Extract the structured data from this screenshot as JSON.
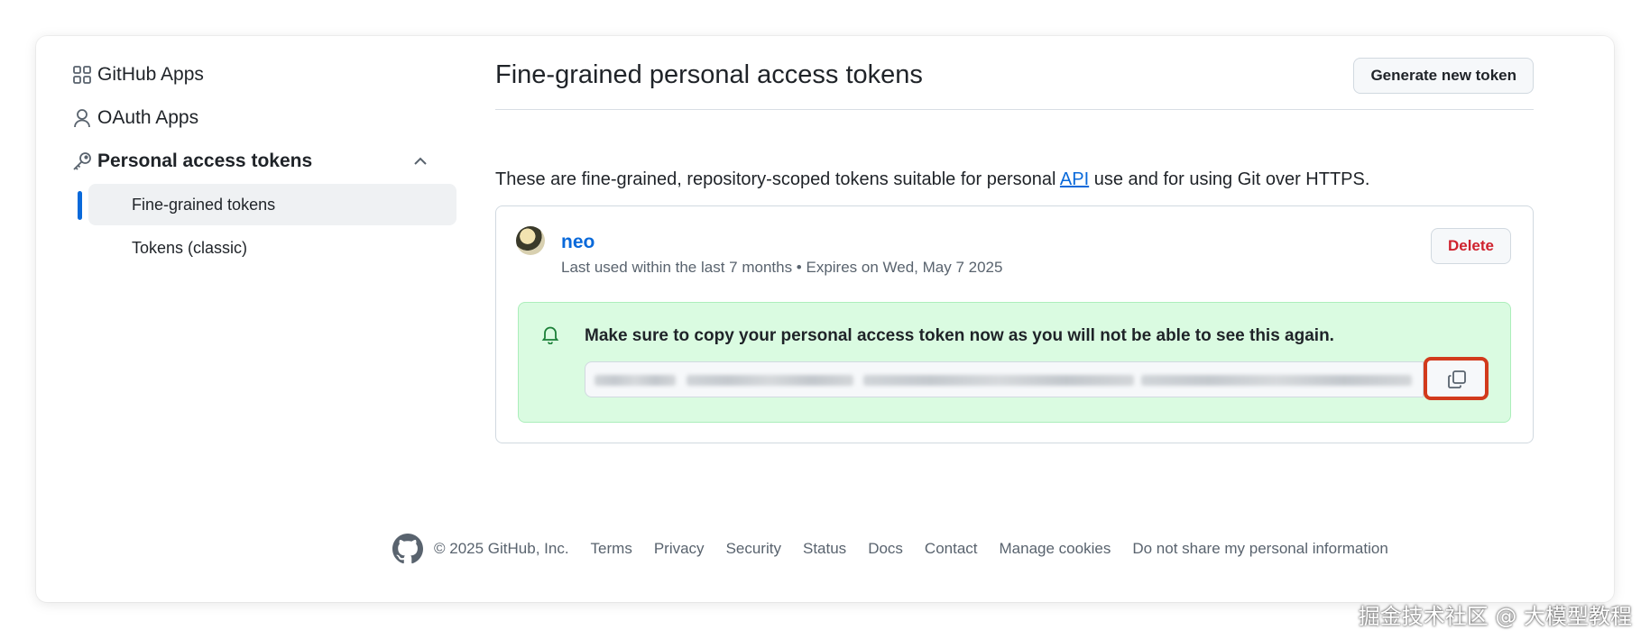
{
  "sidebar": {
    "items": [
      {
        "label": "GitHub Apps",
        "icon": "apps-grid-icon"
      },
      {
        "label": "OAuth Apps",
        "icon": "person-icon"
      },
      {
        "label": "Personal access tokens",
        "icon": "key-icon",
        "expanded": true
      }
    ],
    "sub_items": [
      {
        "label": "Fine-grained tokens",
        "active": true
      },
      {
        "label": "Tokens (classic)",
        "active": false
      }
    ]
  },
  "main": {
    "title": "Fine-grained personal access tokens",
    "generate_button": "Generate new token",
    "description_prefix": "These are fine-grained, repository-scoped tokens suitable for personal ",
    "description_link": "API",
    "description_suffix": " use and for using Git over HTTPS.",
    "token": {
      "name": "neo",
      "meta": "Last used within the last 7 months • Expires on Wed, May 7 2025",
      "delete_button": "Delete",
      "flash_message": "Make sure to copy your personal access token now as you will not be able to see this again.",
      "token_value_hidden": true
    }
  },
  "footer": {
    "copyright": "© 2025 GitHub, Inc.",
    "links": [
      "Terms",
      "Privacy",
      "Security",
      "Status",
      "Docs",
      "Contact",
      "Manage cookies",
      "Do not share my personal information"
    ]
  },
  "watermark": "掘金技术社区 @ 大模型教程",
  "colors": {
    "accent": "#0969da",
    "danger": "#cf222e",
    "success_bg": "#dafbe1",
    "highlight_border": "#d23a1c"
  }
}
